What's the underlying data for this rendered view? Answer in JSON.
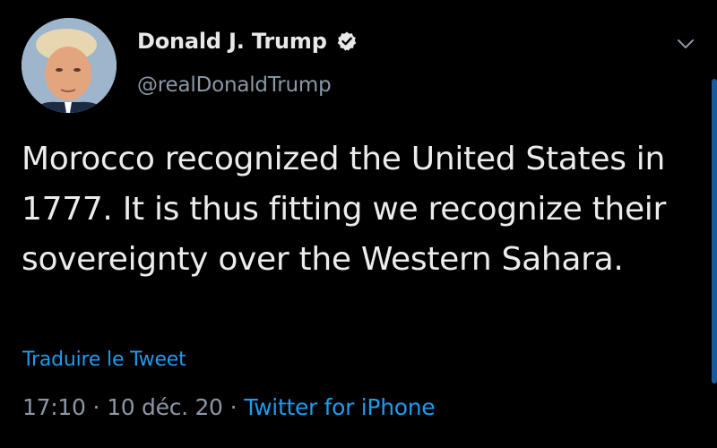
{
  "tweet": {
    "display_name": "Donald J. Trump",
    "handle": "@realDonaldTrump",
    "text": "Morocco recognized the United States in 1777.  It is thus fitting we recognize their sovereignty over the Western Sahara.",
    "translate_label": "Traduire le Tweet",
    "time": "17:10",
    "date": "10 déc. 20",
    "separator": "·",
    "source": "Twitter for iPhone"
  },
  "icons": {
    "verified": "verified-badge-icon",
    "menu": "chevron-down-icon"
  },
  "colors": {
    "background": "#000000",
    "text": "#ececec",
    "secondary": "#8b98a5",
    "link": "#1d9bf0"
  }
}
